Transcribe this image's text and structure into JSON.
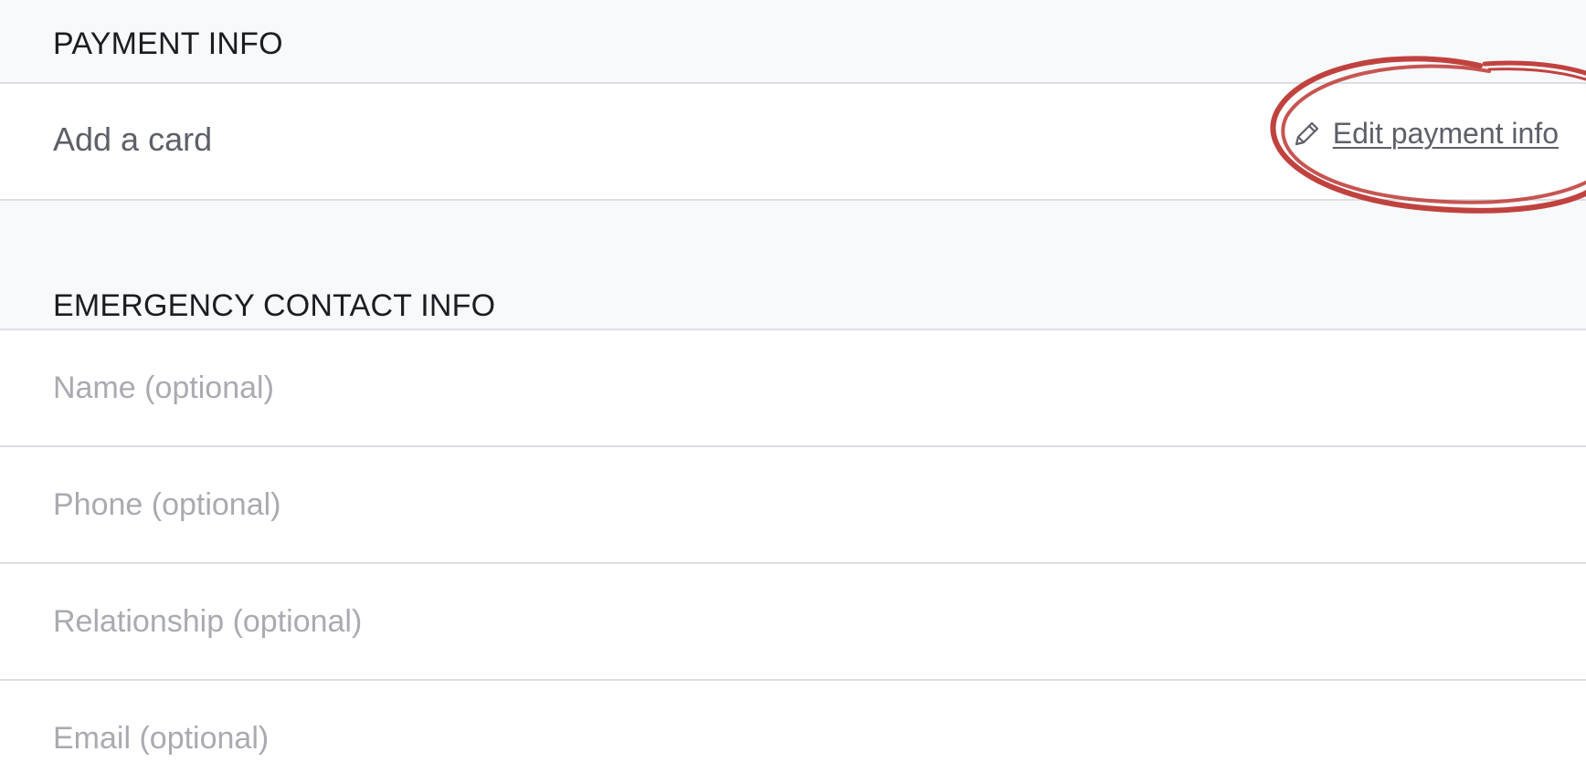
{
  "payment": {
    "section_title": "PAYMENT INFO",
    "card_text": "Add a card",
    "edit_link_label": "Edit payment info",
    "edit_icon": "pencil-icon"
  },
  "emergency": {
    "section_title": "EMERGENCY CONTACT INFO",
    "fields": [
      {
        "placeholder": "Name (optional)",
        "value": ""
      },
      {
        "placeholder": "Phone (optional)",
        "value": ""
      },
      {
        "placeholder": "Relationship (optional)",
        "value": ""
      },
      {
        "placeholder": "Email (optional)",
        "value": ""
      }
    ]
  },
  "colors": {
    "annotation": "#c0423f",
    "section_bg": "#f8f9fa",
    "divider": "#dcdee2",
    "placeholder": "#a9abb1",
    "muted_text": "#5d6068"
  }
}
